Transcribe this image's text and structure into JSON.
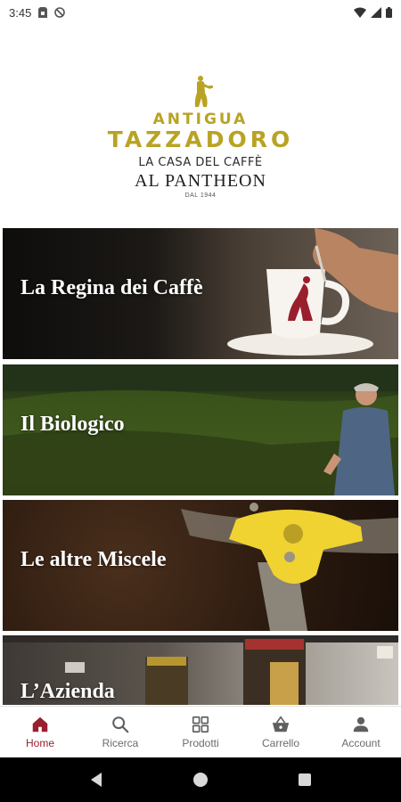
{
  "status_bar": {
    "time": "3:45",
    "left_icons": [
      "sim-card-icon",
      "no-disturb-icon"
    ],
    "right_icons": [
      "wifi-icon",
      "signal-icon",
      "battery-icon"
    ]
  },
  "header": {
    "line1": "ANTIGUA",
    "line2": "TAZZADORO",
    "line3": "LA CASA DEL CAFFÈ",
    "line4": "AL PANTHEON",
    "line5": "DAL 1944",
    "emblem_icon": "coffee-bearer-figure-icon"
  },
  "banners": [
    {
      "title": "La Regina dei Caffè"
    },
    {
      "title": "Il Biologico"
    },
    {
      "title": "Le altre Miscele"
    },
    {
      "title": "L’Azienda"
    }
  ],
  "bottom_nav": {
    "active_color": "#9a1f2e",
    "items": [
      {
        "label": "Home",
        "icon": "home-icon",
        "active": true
      },
      {
        "label": "Ricerca",
        "icon": "search-icon",
        "active": false
      },
      {
        "label": "Prodotti",
        "icon": "grid-icon",
        "active": false
      },
      {
        "label": "Carrello",
        "icon": "basket-icon",
        "active": false
      },
      {
        "label": "Account",
        "icon": "person-icon",
        "active": false
      }
    ]
  },
  "system_nav": {
    "buttons": [
      "back-icon",
      "home-circle-icon",
      "recents-icon"
    ]
  },
  "colors": {
    "brand_gold": "#b8a324",
    "accent_red": "#9a1f2e"
  }
}
